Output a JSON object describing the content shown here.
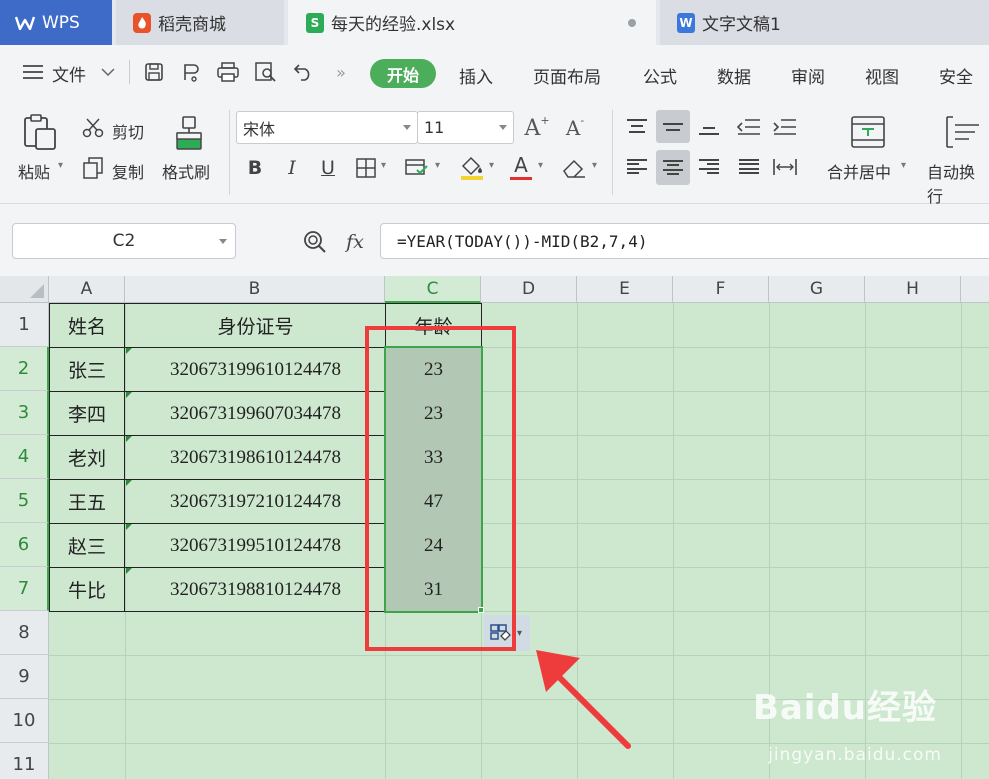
{
  "tabs": [
    {
      "label": "WPS",
      "icon": "wps-logo-icon"
    },
    {
      "label": "稻壳商城",
      "icon": "daoke-icon"
    },
    {
      "label": "每天的经验.xlsx",
      "icon": "spreadsheet-icon"
    },
    {
      "label": "文字文稿1",
      "icon": "writer-icon"
    }
  ],
  "menu": {
    "file": "文件",
    "start": "开始",
    "insert": "插入",
    "page_layout": "页面布局",
    "formula": "公式",
    "data": "数据",
    "review": "审阅",
    "view": "视图",
    "security": "安全"
  },
  "ribbon": {
    "cut": "剪切",
    "copy": "复制",
    "paste": "粘贴",
    "format_painter": "格式刷",
    "font_name": "宋体",
    "font_size": "11",
    "bold": "B",
    "italic": "I",
    "underline": "U",
    "merge_center": "合并居中",
    "auto_wrap": "自动换行"
  },
  "formula_bar": {
    "name_box": "C2",
    "fx": "fx",
    "formula": "=YEAR(TODAY())-MID(B2,7,4)"
  },
  "sheet": {
    "columns": [
      "A",
      "B",
      "C",
      "D",
      "E",
      "F",
      "G",
      "H"
    ],
    "rows": [
      "1",
      "2",
      "3",
      "4",
      "5",
      "6",
      "7",
      "8",
      "9",
      "10",
      "11"
    ],
    "headers": [
      "姓名",
      "身份证号",
      "年龄"
    ],
    "records": [
      {
        "name": "张三",
        "id": "320673199610124478",
        "age": "23"
      },
      {
        "name": "李四",
        "id": "320673199607034478",
        "age": "23"
      },
      {
        "name": "老刘",
        "id": "320673198610124478",
        "age": "33"
      },
      {
        "name": "王五",
        "id": "320673197210124478",
        "age": "47"
      },
      {
        "name": "赵三",
        "id": "320673199510124478",
        "age": "24"
      },
      {
        "name": "牛比",
        "id": "320673198810124478",
        "age": "31"
      }
    ]
  },
  "watermark": {
    "brand": "Baidu经验",
    "url": "jingyan.baidu.com"
  },
  "colors": {
    "accent": "#4cad5b",
    "highlight": "#ee3b3b",
    "sheet_bg": "#cde8cf"
  }
}
